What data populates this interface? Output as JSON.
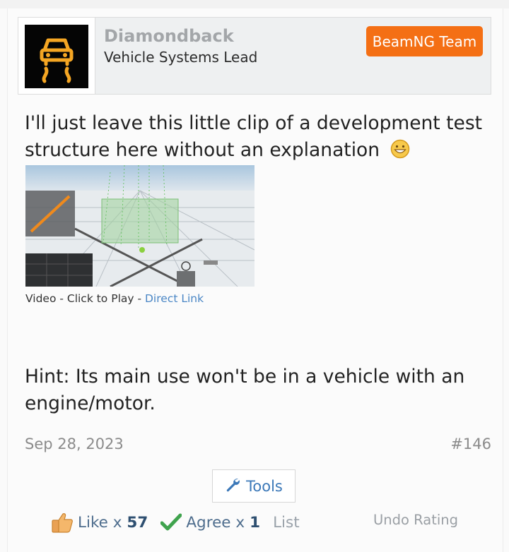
{
  "user": {
    "name": "Diamondback",
    "title": "Vehicle Systems Lead",
    "badge": "BeamNG Team",
    "avatar_icon": "traction-control-warning-icon",
    "badge_color": "#f46f14",
    "avatar_icon_color": "#f5a623"
  },
  "post": {
    "text_1": "I'll just leave this little clip of a development test structure here without an explanation",
    "emoji": "grinning-smiley-icon",
    "video": {
      "caption_prefix": "Video - Click to Play - ",
      "link_text": "Direct Link"
    },
    "text_2": "Hint: Its main use won't be in a vehicle with an engine/motor.",
    "date": "Sep 28, 2023",
    "number": "#146"
  },
  "actions": {
    "tools_label": "Tools",
    "tools_icon": "wrench-icon",
    "like_label": "Like x",
    "like_count": "57",
    "agree_label": "Agree x",
    "agree_count": "1",
    "list_label": "List",
    "undo_label": "Undo Rating"
  },
  "colors": {
    "link": "#4a86c5",
    "agree_check": "#3fa34d",
    "meta_text": "#8b8b8b"
  }
}
